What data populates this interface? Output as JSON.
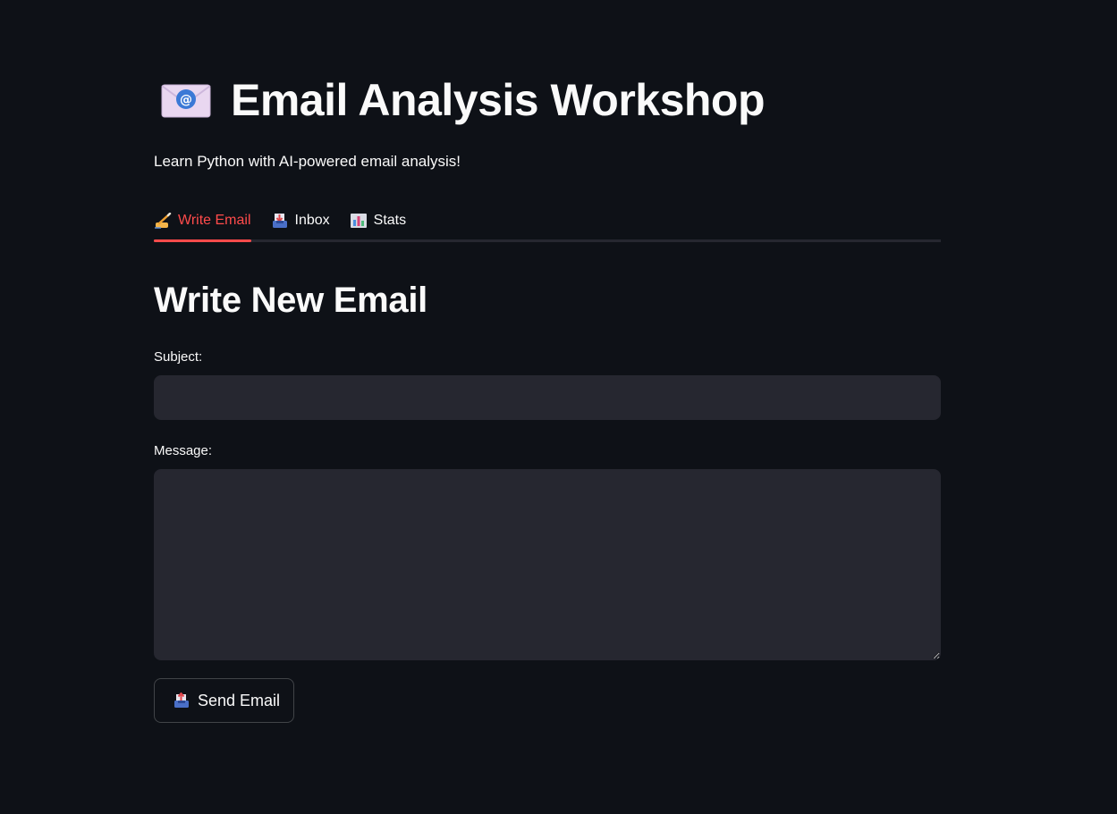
{
  "app": {
    "title": "Email Analysis Workshop",
    "subtitle": "Learn Python with AI-powered email analysis!",
    "icon": "envelope-at-icon"
  },
  "tabs": [
    {
      "label": "Write Email",
      "icon": "writing-hand-icon",
      "active": true
    },
    {
      "label": "Inbox",
      "icon": "inbox-tray-icon",
      "active": false
    },
    {
      "label": "Stats",
      "icon": "bar-chart-icon",
      "active": false
    }
  ],
  "compose": {
    "heading": "Write New Email",
    "subject_label": "Subject:",
    "subject_value": "",
    "message_label": "Message:",
    "message_value": "",
    "send_label": "Send Email",
    "send_icon": "outbox-tray-icon"
  },
  "colors": {
    "background": "#0e1117",
    "input_background": "#262730",
    "accent": "#ff4b4b",
    "text": "#fafafa"
  }
}
